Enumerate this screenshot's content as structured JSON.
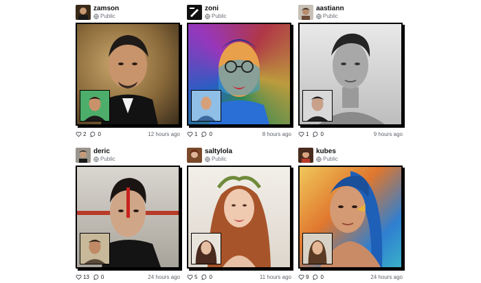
{
  "posts": [
    {
      "username": "zamson",
      "visibility": "Public",
      "likes": "2",
      "comments": "0",
      "time": "12 hours ago"
    },
    {
      "username": "zoni",
      "visibility": "Public",
      "likes": "1",
      "comments": "0",
      "time": "8 hours ago"
    },
    {
      "username": "aastiann",
      "visibility": "Public",
      "likes": "1",
      "comments": "0",
      "time": "9 hours ago"
    },
    {
      "username": "deric",
      "visibility": "Public",
      "likes": "13",
      "comments": "0",
      "time": "24 hours ago"
    },
    {
      "username": "saltylola",
      "visibility": "Public",
      "likes": "5",
      "comments": "0",
      "time": "11 hours ago"
    },
    {
      "username": "kubes",
      "visibility": "Public",
      "likes": "9",
      "comments": "0",
      "time": "24 hours ago"
    }
  ],
  "icons": {
    "visibility": "globe-icon",
    "like": "heart-icon",
    "comment": "comment-icon"
  },
  "colors": {
    "frame_border": "#000000",
    "background": "#ffffff"
  }
}
